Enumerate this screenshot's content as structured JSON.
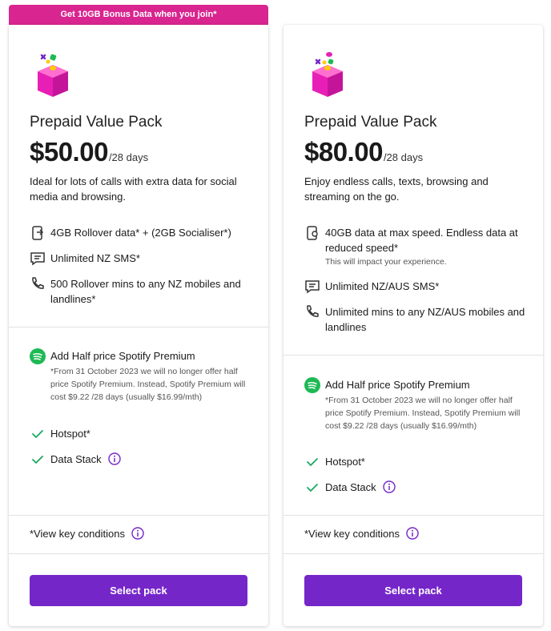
{
  "banner": {
    "text": "Get 10GB Bonus Data when you join*"
  },
  "cards": [
    {
      "name": "Prepaid Value Pack",
      "price": "$50.00",
      "period": "/28 days",
      "description": "Ideal for lots of calls with extra data for social media and browsing.",
      "features": [
        {
          "icon": "data-phone-icon",
          "text": "4GB Rollover data* + (2GB Socialiser*)"
        },
        {
          "icon": "sms-icon",
          "text": "Unlimited NZ SMS*"
        },
        {
          "icon": "phone-icon",
          "text": "500 Rollover mins to any NZ mobiles and landlines*"
        }
      ],
      "spotify": {
        "title": "Add Half price Spotify Premium",
        "note": "*From 31 October 2023 we will no longer offer half price Spotify Premium. Instead, Spotify Premium will cost $9.22 /28 days (usually $16.99/mth)"
      },
      "extras": [
        "Hotspot*",
        "Data Stack"
      ],
      "conditions": "*View key conditions",
      "button": "Select pack"
    },
    {
      "name": "Prepaid Value Pack",
      "price": "$80.00",
      "period": "/28 days",
      "description": "Enjoy endless calls, texts, browsing and streaming on the go.",
      "features": [
        {
          "icon": "data-phone-icon",
          "text": "40GB data at max speed. Endless data at reduced speed*",
          "sub": "This will impact your experience."
        },
        {
          "icon": "sms-icon",
          "text": "Unlimited NZ/AUS SMS*"
        },
        {
          "icon": "phone-icon",
          "text": "Unlimited mins to any NZ/AUS mobiles and landlines"
        }
      ],
      "spotify": {
        "title": "Add Half price Spotify Premium",
        "note": "*From 31 October 2023 we will no longer offer half price Spotify Premium. Instead, Spotify Premium will cost $9.22 /28 days (usually $16.99/mth)"
      },
      "extras": [
        "Hotspot*",
        "Data Stack"
      ],
      "conditions": "*View key conditions",
      "button": "Select pack"
    }
  ],
  "colors": {
    "banner": "#d9258f",
    "button": "#7526c9",
    "check": "#1aa860",
    "spotify": "#1db954",
    "info": "#7526c9"
  }
}
